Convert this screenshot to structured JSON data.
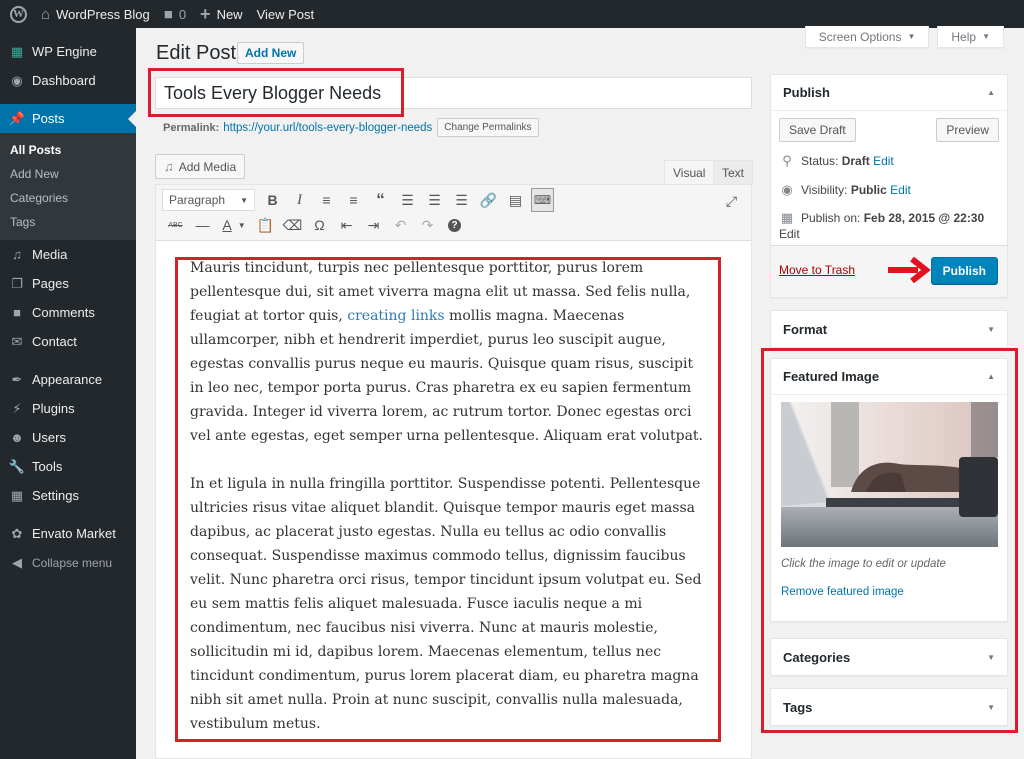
{
  "adminbar": {
    "site_name": "WordPress Blog",
    "comments_count": "0",
    "new_label": "New",
    "view_post_label": "View Post"
  },
  "sidebar": {
    "items": [
      {
        "label": "WP Engine",
        "icon": "grid-icon"
      },
      {
        "label": "Dashboard",
        "icon": "dashboard-icon"
      },
      {
        "label": "Posts",
        "icon": "pin-icon",
        "current": true
      },
      {
        "label": "Media",
        "icon": "media-icon"
      },
      {
        "label": "Pages",
        "icon": "pages-icon"
      },
      {
        "label": "Comments",
        "icon": "comment-icon"
      },
      {
        "label": "Contact",
        "icon": "envelope-icon"
      },
      {
        "label": "Appearance",
        "icon": "brush-icon"
      },
      {
        "label": "Plugins",
        "icon": "plug-icon"
      },
      {
        "label": "Users",
        "icon": "user-icon"
      },
      {
        "label": "Tools",
        "icon": "wrench-icon"
      },
      {
        "label": "Settings",
        "icon": "settings-icon"
      },
      {
        "label": "Envato Market",
        "icon": "leaf-icon"
      }
    ],
    "posts_submenu": [
      "All Posts",
      "Add New",
      "Categories",
      "Tags"
    ],
    "collapse_label": "Collapse menu"
  },
  "screen_meta": {
    "screen_options": "Screen Options",
    "help": "Help"
  },
  "header": {
    "title": "Edit Post",
    "add_new": "Add New"
  },
  "post": {
    "title": "Tools Every Blogger Needs",
    "permalink_label": "Permalink:",
    "permalink_url": "https://your.url/tools-every-blogger-needs",
    "change_permalinks": "Change Permalinks"
  },
  "editor": {
    "add_media": "Add Media",
    "tabs": {
      "visual": "Visual",
      "text": "Text"
    },
    "active_tab": "Visual",
    "format_select": "Paragraph",
    "paragraphs": [
      {
        "before_link": "Mauris tincidunt, turpis nec pellentesque porttitor, purus lorem pellentesque dui, sit amet viverra magna elit ut massa. Sed felis nulla, feugiat at tortor quis, ",
        "link_text": "creating links",
        "after_link": " mollis magna. Maecenas ullamcorper, nibh et hendrerit imperdiet, purus leo suscipit augue, egestas convallis purus neque eu mauris. Quisque quam risus, suscipit in leo nec, tempor porta purus. Cras pharetra ex eu sapien fermentum gravida. Integer id viverra lorem, ac rutrum tortor. Donec egestas orci vel ante egestas, eget semper urna pellentesque. Aliquam erat volutpat."
      },
      {
        "text": "In et ligula in nulla fringilla porttitor. Suspendisse potenti. Pellentesque ultricies risus vitae aliquet blandit. Quisque tempor mauris eget massa dapibus, ac placerat justo egestas. Nulla eu tellus ac odio convallis consequat. Suspendisse maximus commodo tellus, dignissim faucibus velit. Nunc pharetra orci risus, tempor tincidunt ipsum volutpat eu. Sed eu sem mattis felis aliquet malesuada. Fusce iaculis neque a mi condimentum, nec faucibus nisi viverra. Nunc at mauris molestie, sollicitudin mi id, dapibus lorem. Maecenas elementum, tellus nec tincidunt condimentum, purus lorem placerat diam, eu pharetra magna nibh sit amet nulla. Proin at nunc suscipit, convallis nulla malesuada, vestibulum metus."
      }
    ]
  },
  "publish": {
    "title": "Publish",
    "save_draft": "Save Draft",
    "preview": "Preview",
    "status_label": "Status:",
    "status_value": "Draft",
    "visibility_label": "Visibility:",
    "visibility_value": "Public",
    "publish_on_label": "Publish on:",
    "publish_on_value": "Feb 28, 2015 @ 22:30",
    "edit": "Edit",
    "move_to_trash": "Move to Trash",
    "publish_button": "Publish"
  },
  "boxes": {
    "format": "Format",
    "featured_image": "Featured Image",
    "featured_caption": "Click the image to edit or update",
    "remove_featured": "Remove featured image",
    "categories": "Categories",
    "tags": "Tags"
  },
  "colors": {
    "accent": "#0073aa",
    "publish_button": "#0085ba",
    "admin_dark": "#23282d",
    "annotation_red": "#d71f2b"
  }
}
